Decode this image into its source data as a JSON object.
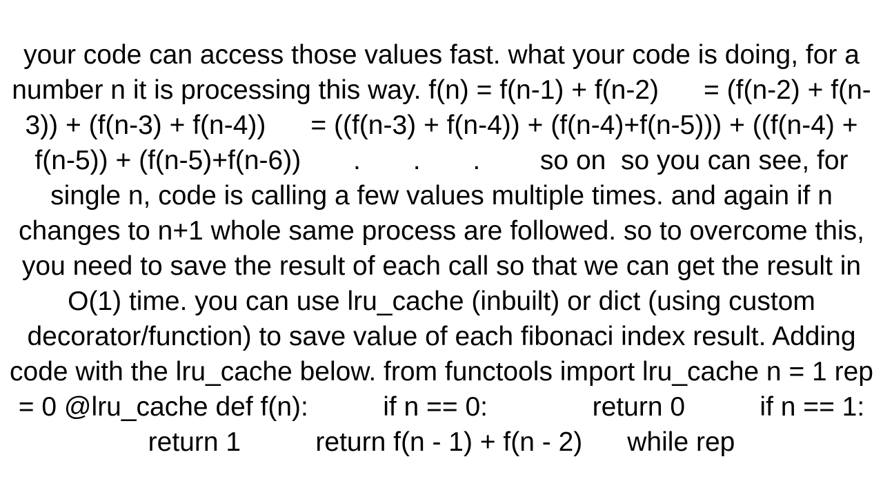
{
  "document": {
    "body_text": "your code can access those values fast. what your code is doing, for a number n it is processing this way. f(n) = f(n-1) + f(n-2)      = (f(n-2) + f(n-3)) + (f(n-3) + f(n-4))      = ((f(n-3) + f(n-4)) + (f(n-4)+f(n-5))) + ((f(n-4) + f(n-5)) + (f(n-5)+f(n-6))       .       .       .        so on  so you can see, for single n, code is calling a few values multiple times. and again if n changes to n+1 whole same process are followed. so to overcome this, you need to save the result of each call so that we can get the result in O(1) time. you can use lru_cache (inbuilt) or dict (using custom decorator/function) to save value of each fibonaci index result. Adding code with the lru_cache below. from functools import lru_cache n = 1 rep = 0 @lru_cache def f(n):          if n == 0:              return 0          if n == 1:              return 1          return f(n - 1) + f(n - 2)      while rep"
  }
}
